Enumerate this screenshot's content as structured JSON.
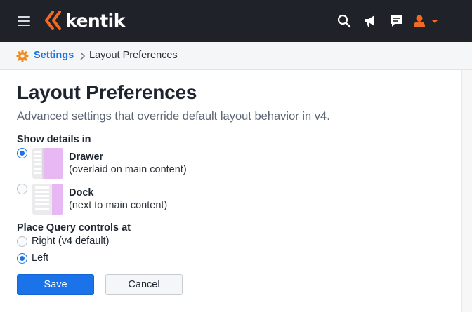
{
  "header": {
    "brand": "kentik",
    "brand_color": "#f26a21",
    "icons": [
      "menu-icon",
      "search-icon",
      "megaphone-icon",
      "chat-icon",
      "user-icon"
    ]
  },
  "breadcrumb": {
    "parent": "Settings",
    "current": "Layout Preferences"
  },
  "page": {
    "title": "Layout Preferences",
    "description": "Advanced settings that override default layout behavior in v4."
  },
  "details_section": {
    "label": "Show details in",
    "options": [
      {
        "title": "Drawer",
        "subtitle": "(overlaid on main content)",
        "selected": true
      },
      {
        "title": "Dock",
        "subtitle": "(next to main content)",
        "selected": false
      }
    ]
  },
  "query_section": {
    "label": "Place Query controls at",
    "options": [
      {
        "label": "Right (v4 default)",
        "selected": false
      },
      {
        "label": "Left",
        "selected": true
      }
    ]
  },
  "actions": {
    "save_label": "Save",
    "cancel_label": "Cancel"
  },
  "colors": {
    "accent": "#1a73e8",
    "nav_bg": "#1f2329",
    "thumb_highlight": "#e8b8f4"
  }
}
